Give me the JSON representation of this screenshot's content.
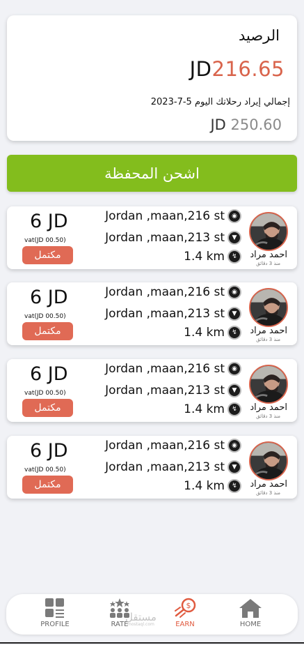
{
  "balance": {
    "title": "الرصيد",
    "currency": "JD",
    "amount": "216.65",
    "subtitle": "إجمالي إيراد رحلاتك اليوم 5-7-2023",
    "total_currency": "JD",
    "total_amount": "250.60"
  },
  "charge_button": {
    "label": "اشحن المحفظة"
  },
  "trips": [
    {
      "pickup": "Jordan ,maan,216 st",
      "dropoff": "Jordan ,maan,213 st",
      "distance": "1.4 km",
      "driver_name": "احمد مراد",
      "time_ago": "منذ 3 دقائق",
      "fare": "6 JD",
      "vat": "vat(JD 00.50)",
      "status": "مكتمل"
    },
    {
      "pickup": "Jordan ,maan,216 st",
      "dropoff": "Jordan ,maan,213 st",
      "distance": "1.4 km",
      "driver_name": "احمد مراد",
      "time_ago": "منذ 3 دقائق",
      "fare": "6 JD",
      "vat": "vat(JD 00.50)",
      "status": "مكتمل"
    },
    {
      "pickup": "Jordan ,maan,216 st",
      "dropoff": "Jordan ,maan,213 st",
      "distance": "1.4 km",
      "driver_name": "احمد مراد",
      "time_ago": "منذ 3 دقائق",
      "fare": "6 JD",
      "vat": "vat(JD 00.50)",
      "status": "مكتمل"
    },
    {
      "pickup": "Jordan ,maan,216 st",
      "dropoff": "Jordan ,maan,213 st",
      "distance": "1.4 km",
      "driver_name": "احمد مراد",
      "time_ago": "منذ 3 دقائق",
      "fare": "6 JD",
      "vat": "vat(JD 00.50)",
      "status": "مكتمل"
    }
  ],
  "nav": {
    "profile": "PROFILE",
    "rate": "RATE",
    "earn": "EARN",
    "home": "HOME"
  },
  "watermark": {
    "text": "مستقل",
    "sub": "mostaql.com"
  },
  "colors": {
    "accent": "#d9644c",
    "charge_button": "#83bd1d",
    "status_button": "#e06a55",
    "background": "#f1f2f6"
  },
  "icons": {
    "pickup": "pin-icon",
    "dropoff": "direction-arrow-icon",
    "distance": "route-icon",
    "profile": "grid-icon",
    "rate": "crowd-icon",
    "earn": "money-rocket-icon",
    "home": "house-icon"
  }
}
